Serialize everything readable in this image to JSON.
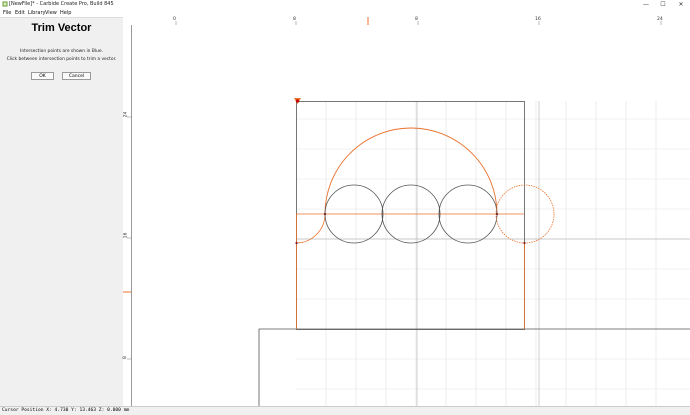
{
  "window": {
    "title": "[NewFile]* - Carbide Create Pro, Build 845",
    "minimize_glyph": "—",
    "maximize_glyph": "☐",
    "close_glyph": "✕"
  },
  "menu": [
    "File",
    "Edit",
    "Library",
    "View",
    "Help"
  ],
  "panel": {
    "title": "Trim Vector",
    "line1": "Intersection points are shown in Blue.",
    "line2": "Click between intersection points to trim a vector.",
    "ok_label": "OK",
    "cancel_label": "Cancel"
  },
  "rulers": {
    "top_ticks": [
      "0",
      "8",
      "8",
      "16",
      "24"
    ],
    "left_ticks": [
      "24",
      "16",
      "8"
    ]
  },
  "status": {
    "text": "Cursor Position X: 4.730 Y: 13.463 Z: 0.000 mm"
  },
  "colors": {
    "accent": "#e8722c",
    "toolpath": "#e8722c",
    "vector": "#555555",
    "grid": "#e0e0e0"
  },
  "icons": {
    "app": "carbide-create-icon",
    "origin": "origin-marker-icon"
  }
}
